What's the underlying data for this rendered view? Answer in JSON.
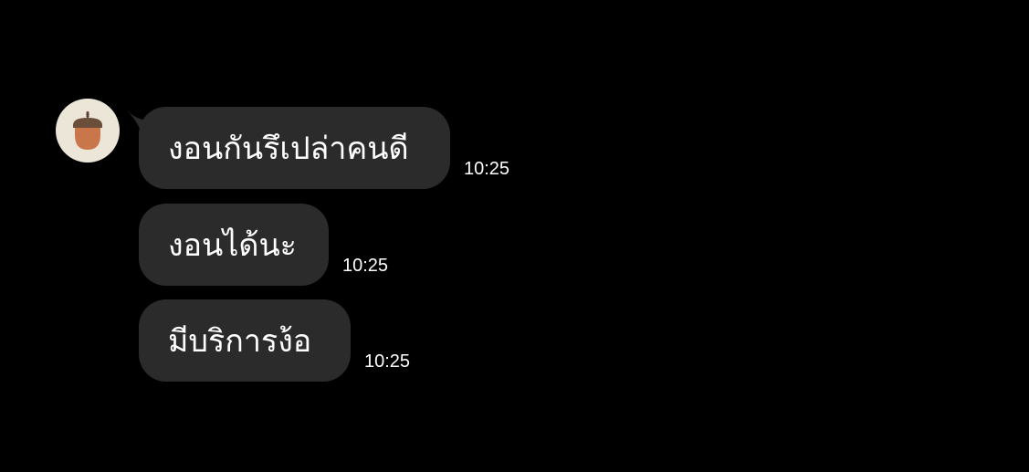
{
  "chat": {
    "contact": {
      "avatar_icon": "acorn-icon"
    },
    "messages": [
      {
        "text": "งอนกันรึเปล่าคนดี",
        "time": "10:25"
      },
      {
        "text": "งอนได้นะ",
        "time": "10:25"
      },
      {
        "text": "มีบริการง้อ",
        "time": "10:25"
      }
    ]
  },
  "colors": {
    "background": "#000000",
    "bubble": "#2b2b2b",
    "text": "#ffffff",
    "avatar_bg": "#ece6d9",
    "acorn_cap": "#6b4f3a",
    "acorn_body": "#c8764a"
  }
}
